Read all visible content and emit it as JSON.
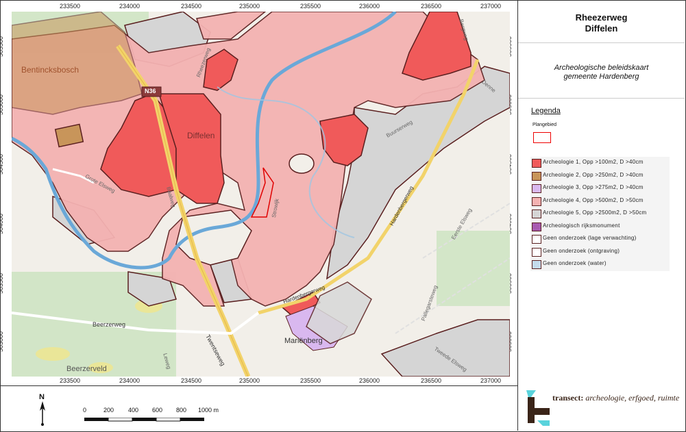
{
  "title": {
    "line1": "Rheezerweg",
    "line2": "Diffelen"
  },
  "subtitle": {
    "line1": "Archeologische beleidskaart",
    "line2": "gemeente Hardenberg"
  },
  "legend": {
    "heading": "Legenda",
    "planarea_label": "Plangebied",
    "planarea_color": "#e00000",
    "items": [
      {
        "label": "Archeologie 1, Opp >100m2,  D >40cm",
        "color": "#f05a5a"
      },
      {
        "label": "Archeologie 2, Opp >250m2,  D >40cm",
        "color": "#c8955a"
      },
      {
        "label": "Archeologie 3, Opp >275m2,  D >40cm",
        "color": "#d9b8ef"
      },
      {
        "label": "Archeologie 4, Opp >500m2,  D >50cm",
        "color": "#f4b2b2"
      },
      {
        "label": "Archeologie 5, Opp >2500m2,  D >50cm",
        "color": "#d5d5d5"
      },
      {
        "label": "Archeologisch rijksmonument",
        "color": "#a85ab0"
      },
      {
        "label": "Geen onderzoek (lage verwachting)",
        "color": "#ffffff"
      },
      {
        "label": "Geen onderzoek (ontgraving)",
        "color": "#ffffff"
      },
      {
        "label": "Geen onderzoek (water)",
        "color": "#c4dced"
      }
    ]
  },
  "axes": {
    "x_ticks": [
      "233500",
      "234000",
      "234500",
      "235000",
      "235500",
      "236000",
      "236500",
      "237000"
    ],
    "y_ticks": [
      "505500",
      "505000",
      "504500",
      "504000",
      "503500",
      "503000"
    ]
  },
  "map_labels": {
    "bentincksbosch": "Bentincksbosch",
    "diffelen": "Diffelen",
    "n36": "N36",
    "beerzerweg": "Beerzerweg",
    "beerzerveld": "Beerzerveld",
    "mariënberg": "Mariënberg",
    "twentseweg": "Twentseweg",
    "grote_elsweg": "Grote Elsweg",
    "strowijk": "Strowijk",
    "hardenbergerweg": "Hardenbergerweg",
    "buurserweg": "Buurserweg",
    "eerste_elsweg": "Eerste Elsweg",
    "tweede_elsweg": "Tweede Elsweg",
    "pallegarsteweg": "Pallegarsteweg",
    "dennenweg": "Denne",
    "rheezerweg": "Rheezerweg",
    "bergweg": "Bergweg",
    "baalweg": "Baalweg",
    "lemeweg": "Leweg"
  },
  "scale": {
    "labels": [
      "0",
      "200",
      "400",
      "600",
      "800",
      "1000 m"
    ]
  },
  "north_arrow": {
    "label": "N",
    "icon": "north-arrow-icon"
  },
  "logo": {
    "brand": "transect:",
    "tagline": "archeologie, erfgoed, ruimte",
    "icon": "transect-logo-icon"
  }
}
